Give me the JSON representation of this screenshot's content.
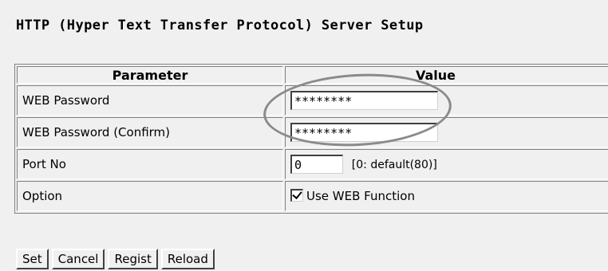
{
  "title": "HTTP (Hyper Text Transfer Protocol) Server Setup",
  "table": {
    "headers": {
      "parameter": "Parameter",
      "value": "Value"
    },
    "rows": [
      {
        "label": "WEB Password",
        "value": "********"
      },
      {
        "label": "WEB Password (Confirm)",
        "value": "********"
      },
      {
        "label": "Port No",
        "value": "0",
        "hint": "[0: default(80)]"
      },
      {
        "label": "Option",
        "checkbox_label": "Use WEB Function",
        "checked": true
      }
    ]
  },
  "buttons": {
    "set": "Set",
    "cancel": "Cancel",
    "regist": "Regist",
    "reload": "Reload"
  },
  "annotation": {
    "shape": "ellipse",
    "color": "#8a8a8a"
  }
}
